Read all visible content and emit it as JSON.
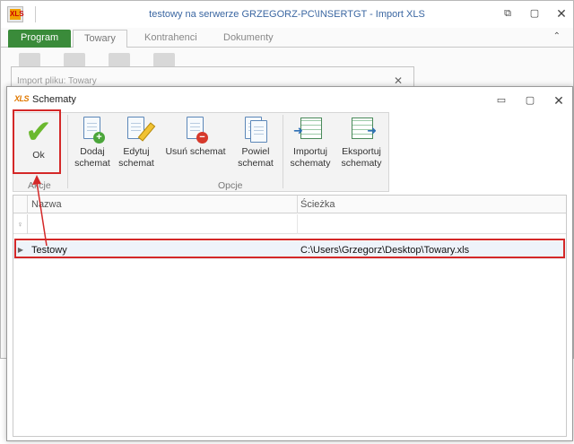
{
  "main_window": {
    "title": "testowy na serwerze GRZEGORZ-PC\\INSERTGT - Import XLS",
    "tabs": [
      "Program",
      "Towary",
      "Kontrahenci",
      "Dokumenty"
    ],
    "import_label": "Import pliku: Towary"
  },
  "dialog": {
    "icon_text": "XLS",
    "title": "Schematy",
    "ribbon": {
      "ok": "Ok",
      "akcje": "Akcje",
      "add_line1": "Dodaj",
      "add_line2": "schemat",
      "edit_line1": "Edytuj",
      "edit_line2": "schemat",
      "delete": "Usuń schemat",
      "dup_line1": "Powiel",
      "dup_line2": "schemat",
      "import_line1": "Importuj",
      "import_line2": "schematy",
      "export_line1": "Eksportuj",
      "export_line2": "schematy",
      "opcje": "Opcje"
    },
    "grid": {
      "columns": [
        "Nazwa",
        "Ścieżka"
      ],
      "rows": [
        {
          "name": "Testowy",
          "path": "C:\\Users\\Grzegorz\\Desktop\\Towary.xls"
        }
      ]
    }
  },
  "colors": {
    "program_tab": "#3a8b3a",
    "highlight": "#d42828",
    "title_blue": "#3b67a2"
  }
}
